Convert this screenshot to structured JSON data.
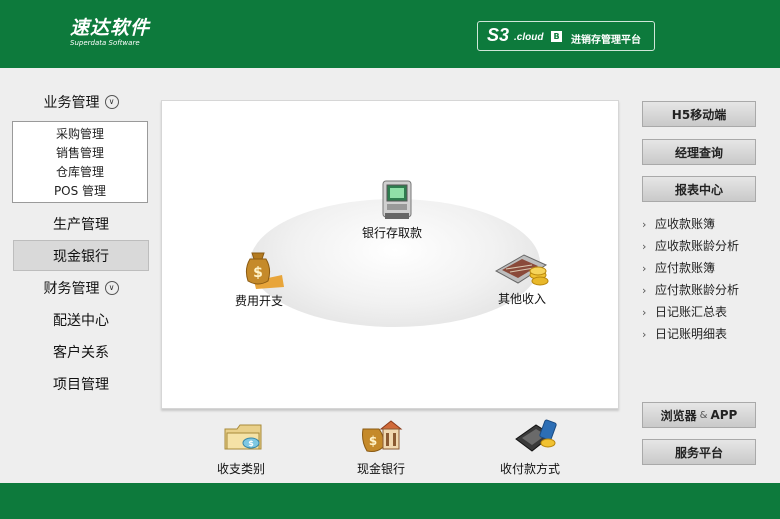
{
  "header": {
    "logo_cn": "速达软件",
    "logo_en": "Superdata Software",
    "product_name": "S3",
    "product_cloud": ".cloud",
    "product_badge": "B",
    "product_desc": "进销存管理平台",
    "bg_color": "#0d7a3c"
  },
  "nav": {
    "items": [
      {
        "label": "业务管理",
        "icon": "chevron-down-circle-icon"
      },
      {
        "label": "生产管理"
      },
      {
        "label": "现金银行",
        "active": true
      },
      {
        "label": "财务管理",
        "icon": "chevron-down-circle-icon"
      },
      {
        "label": "配送中心"
      },
      {
        "label": "客户关系"
      },
      {
        "label": "项目管理"
      }
    ],
    "sub_items": [
      "采购管理",
      "销售管理",
      "仓库管理",
      "POS 管理"
    ]
  },
  "center": {
    "features": [
      {
        "label": "银行存取款",
        "icon": "atm-icon"
      },
      {
        "label": "费用开支",
        "icon": "money-bag-icon"
      },
      {
        "label": "其他收入",
        "icon": "cash-register-coins-icon"
      }
    ],
    "bottom": [
      {
        "label": "收支类别",
        "icon": "folder-coins-icon"
      },
      {
        "label": "现金银行",
        "icon": "bank-icon"
      },
      {
        "label": "收付款方式",
        "icon": "pos-terminal-icon"
      }
    ]
  },
  "right": {
    "buttons": [
      "H5移动端",
      "经理查询",
      "报表中心"
    ],
    "links": [
      "应收款账簿",
      "应收款账龄分析",
      "应付款账簿",
      "应付款账龄分析",
      "日记账汇总表",
      "日记账明细表"
    ],
    "bottom_buttons": {
      "browser": "浏览器",
      "amp": "&",
      "app": "APP",
      "service": "服务平台"
    }
  }
}
